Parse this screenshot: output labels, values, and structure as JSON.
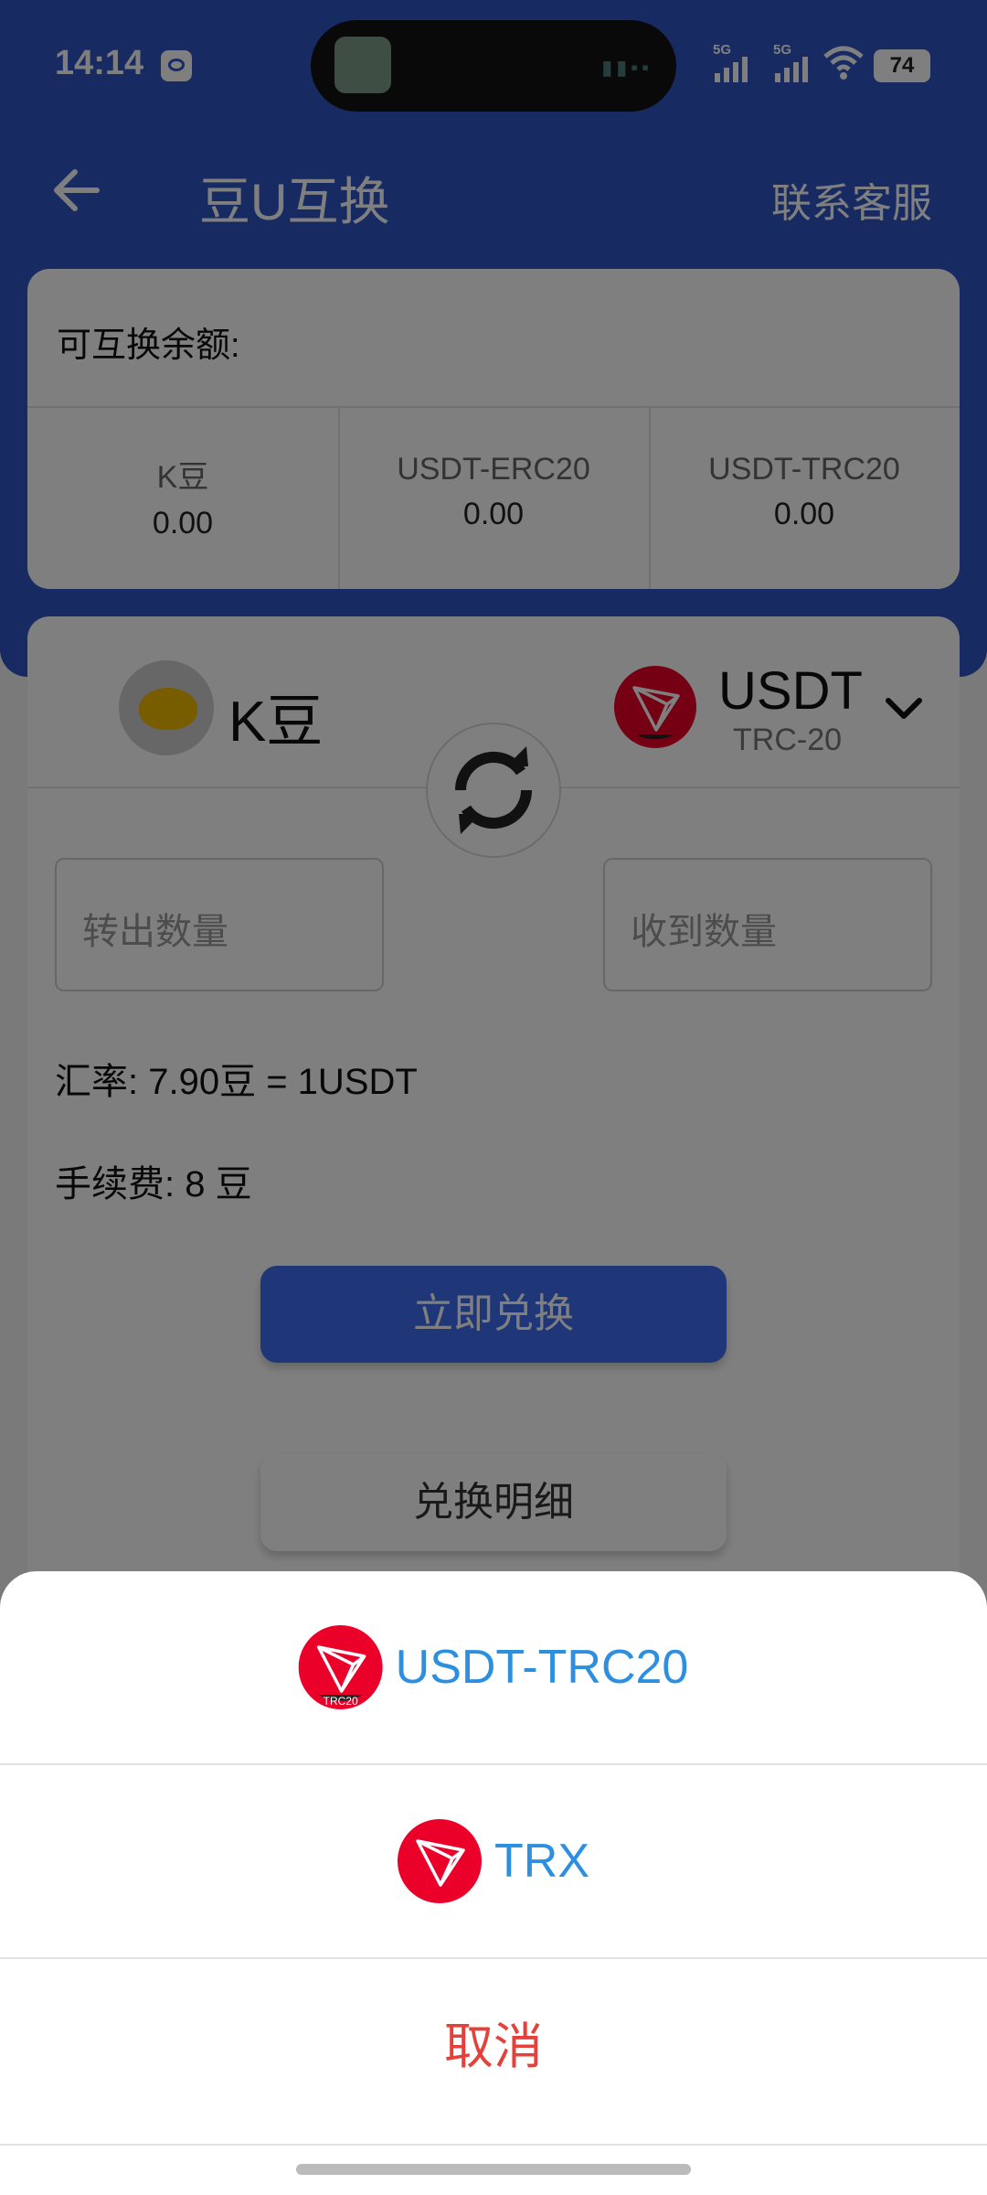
{
  "status_bar": {
    "time": "14:14",
    "signal1": "5G",
    "signal2": "5G",
    "battery": "74"
  },
  "app_bar": {
    "title": "豆U互换",
    "contact": "联系客服"
  },
  "balance": {
    "label": "可互换余额:",
    "columns": [
      {
        "name": "K豆",
        "value": "0.00"
      },
      {
        "name": "USDT-ERC20",
        "value": "0.00"
      },
      {
        "name": "USDT-TRC20",
        "value": "0.00"
      }
    ]
  },
  "exchange": {
    "from_coin": "K豆",
    "to_coin": "USDT",
    "to_coin_sub": "TRC-20",
    "out_placeholder": "转出数量",
    "in_placeholder": "收到数量",
    "rate": "汇率: 7.90豆 = 1USDT",
    "fee": "手续费: 8 豆",
    "submit": "立即兑换",
    "details": "兑换明细"
  },
  "sheet": {
    "options": [
      {
        "label": "USDT-TRC20",
        "icon_badge": "TRC20"
      },
      {
        "label": "TRX"
      }
    ],
    "cancel": "取消"
  },
  "colors": {
    "primary": "#2f57c5",
    "button": "#3e6ff2",
    "option_text": "#2d8fe0",
    "cancel_text": "#e5413a",
    "tron_red": "#eb0029"
  }
}
